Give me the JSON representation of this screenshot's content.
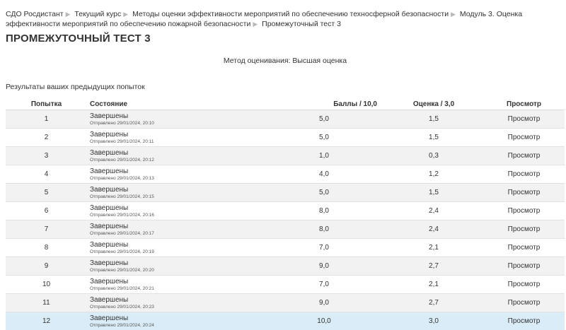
{
  "breadcrumb": {
    "items": [
      "СДО Росдистант",
      "Текущий курс",
      "Методы оценки эффективности мероприятий по обеспечению техносферной безопасности",
      "Модуль 3. Оценка эффективности мероприятий по обеспечению пожарной безопасности",
      "Промежуточный тест 3"
    ],
    "separator_icon": "arrow-icon"
  },
  "page_title": "ПРОМЕЖУТОЧНЫЙ ТЕСТ 3",
  "grading_method": "Метод оценивания: Высшая оценка",
  "previous_attempts_title": "Результаты ваших предыдущих попыток",
  "table": {
    "headers": [
      "Попытка",
      "Состояние",
      "Баллы / 10,0",
      "Оценка / 3,0",
      "Просмотр"
    ],
    "rows": [
      {
        "attempt": "1",
        "state": "Завершены",
        "submitted": "Отправлено 29/01/2024, 20:10",
        "marks": "5,0",
        "grade": "1,5",
        "review": "Просмотр"
      },
      {
        "attempt": "2",
        "state": "Завершены",
        "submitted": "Отправлено 29/01/2024, 20:11",
        "marks": "5,0",
        "grade": "1,5",
        "review": "Просмотр"
      },
      {
        "attempt": "3",
        "state": "Завершены",
        "submitted": "Отправлено 29/01/2024, 20:12",
        "marks": "1,0",
        "grade": "0,3",
        "review": "Просмотр"
      },
      {
        "attempt": "4",
        "state": "Завершены",
        "submitted": "Отправлено 29/01/2024, 20:13",
        "marks": "4,0",
        "grade": "1,2",
        "review": "Просмотр"
      },
      {
        "attempt": "5",
        "state": "Завершены",
        "submitted": "Отправлено 29/01/2024, 20:15",
        "marks": "5,0",
        "grade": "1,5",
        "review": "Просмотр"
      },
      {
        "attempt": "6",
        "state": "Завершены",
        "submitted": "Отправлено 29/01/2024, 20:16",
        "marks": "8,0",
        "grade": "2,4",
        "review": "Просмотр"
      },
      {
        "attempt": "7",
        "state": "Завершены",
        "submitted": "Отправлено 29/01/2024, 20:17",
        "marks": "8,0",
        "grade": "2,4",
        "review": "Просмотр"
      },
      {
        "attempt": "8",
        "state": "Завершены",
        "submitted": "Отправлено 29/01/2024, 20:19",
        "marks": "7,0",
        "grade": "2,1",
        "review": "Просмотр"
      },
      {
        "attempt": "9",
        "state": "Завершены",
        "submitted": "Отправлено 29/01/2024, 20:20",
        "marks": "9,0",
        "grade": "2,7",
        "review": "Просмотр"
      },
      {
        "attempt": "10",
        "state": "Завершены",
        "submitted": "Отправлено 29/01/2024, 20:21",
        "marks": "7,0",
        "grade": "2,1",
        "review": "Просмотр"
      },
      {
        "attempt": "11",
        "state": "Завершены",
        "submitted": "Отправлено 29/01/2024, 20:23",
        "marks": "9,0",
        "grade": "2,7",
        "review": "Просмотр"
      },
      {
        "attempt": "12",
        "state": "Завершены",
        "submitted": "Отправлено 29/01/2024, 20:24",
        "marks": "10,0",
        "grade": "3,0",
        "review": "Просмотр"
      }
    ]
  },
  "colors": {
    "row_striped": "#f2f2f2",
    "row_highlight": "#d9ecf7",
    "text": "#333333"
  }
}
